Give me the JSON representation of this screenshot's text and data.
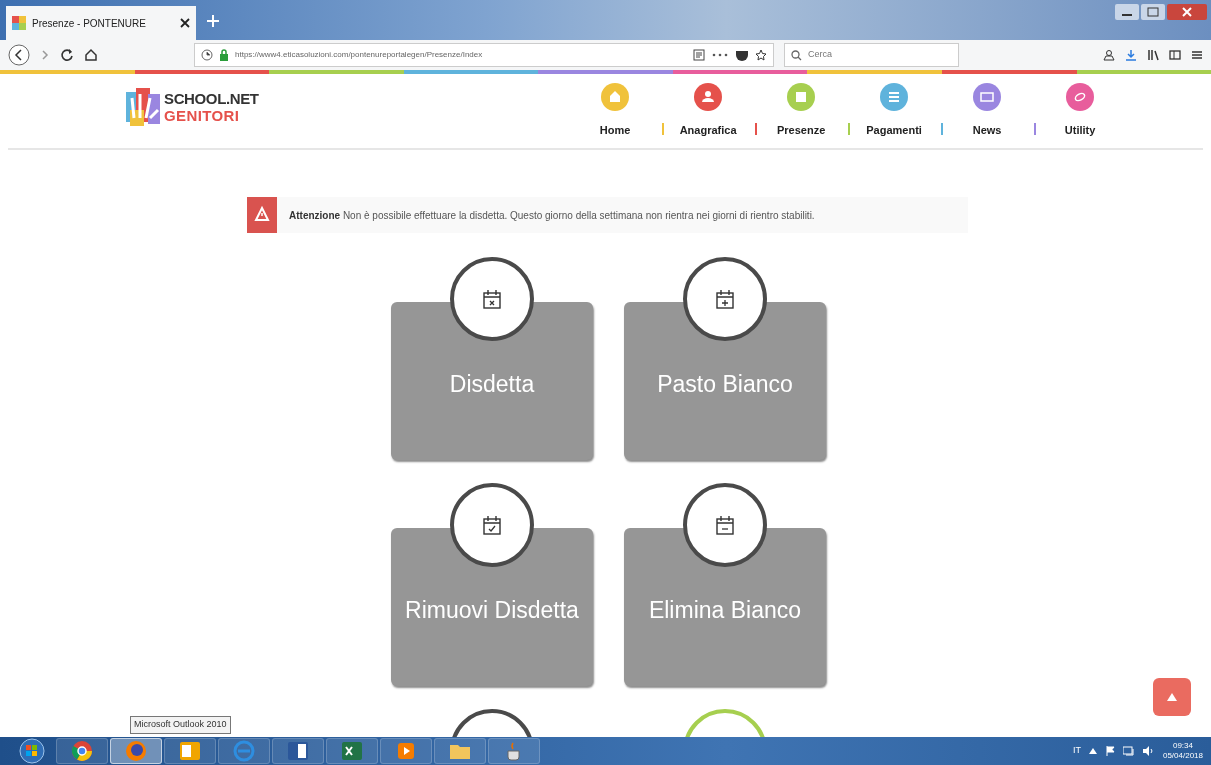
{
  "browser": {
    "tab_title": "Presenze - PONTENURE",
    "url": "https://www4.eticasoluzioni.com/pontenureportalegen/Presenze/Index",
    "search": {
      "placeholder": "Cerca"
    }
  },
  "logo": {
    "line_1": "SCHOOL.NET",
    "line_2": "GENITORI"
  },
  "nav": [
    {
      "label": "Home",
      "color": "#f0c23b",
      "kind": "home"
    },
    {
      "label": "Anagrafica",
      "color": "#e5514b",
      "kind": "user"
    },
    {
      "label": "Presenze",
      "color": "#a7cf4f",
      "kind": "calendar"
    },
    {
      "label": "Pagamenti",
      "color": "#5fb3dc",
      "kind": "list"
    },
    {
      "label": "News",
      "color": "#9a86e0",
      "kind": "news"
    },
    {
      "label": "Utility",
      "color": "#e85d9c",
      "kind": "link"
    }
  ],
  "alert": {
    "title": "Attenzione",
    "message": "Non è possibile effettuare la disdetta. Questo giorno della settimana non rientra nei giorni di rientro stabiliti."
  },
  "tiles": [
    {
      "label": "Disdetta",
      "kind": "x"
    },
    {
      "label": "Pasto Bianco",
      "kind": "plus"
    },
    {
      "label": "Rimuovi Disdetta",
      "kind": "check"
    },
    {
      "label": "Elimina Bianco",
      "kind": "minus"
    }
  ],
  "partial_tiles": [
    {
      "color": "#4a4a4a"
    },
    {
      "color": "#a6cf4f"
    }
  ],
  "tooltip": "Microsoft Outlook 2010",
  "taskbar": {
    "apps": [
      {
        "kind": "chrome",
        "selected": false
      },
      {
        "kind": "firefox",
        "selected": true
      },
      {
        "kind": "outlook",
        "selected": false
      },
      {
        "kind": "ie",
        "selected": false
      },
      {
        "kind": "word",
        "selected": false
      },
      {
        "kind": "excel",
        "selected": false
      },
      {
        "kind": "player",
        "selected": false
      },
      {
        "kind": "folder",
        "selected": false
      },
      {
        "kind": "java",
        "selected": false
      }
    ],
    "language": "IT",
    "time": "09:34",
    "date": "05/04/2018"
  }
}
